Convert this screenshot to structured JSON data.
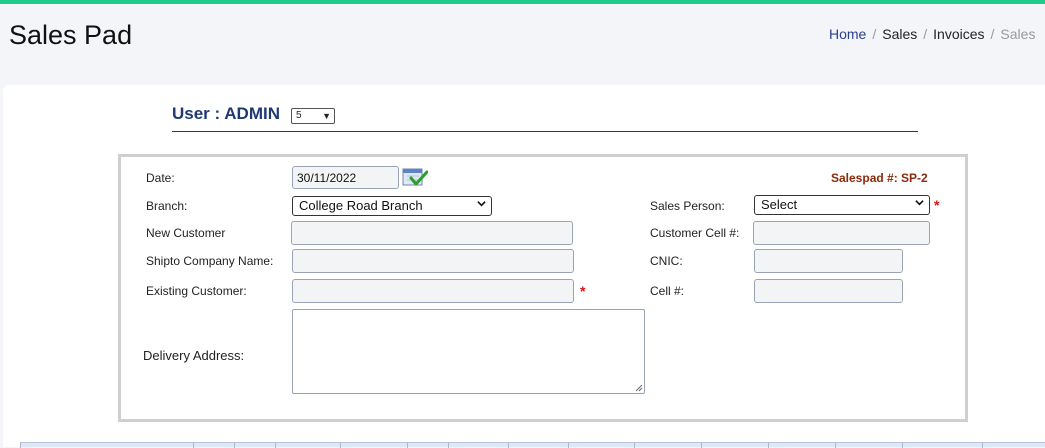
{
  "header": {
    "title": "Sales Pad",
    "breadcrumb": [
      "Home",
      "Sales",
      "Invoices",
      "Sales"
    ],
    "separator": "/"
  },
  "user": {
    "label": "User : ADMIN",
    "selected": "5"
  },
  "form": {
    "date_label": "Date:",
    "date_value": "30/11/2022",
    "salespad_label": "Salespad #: SP-2",
    "branch_label": "Branch:",
    "branch_value": "College Road Branch",
    "sales_person_label": "Sales Person:",
    "sales_person_value": "Select",
    "new_customer_label": "New Customer",
    "new_customer_value": "",
    "customer_cell_label": "Customer Cell #:",
    "customer_cell_value": "",
    "shipto_label": "Shipto Company Name:",
    "shipto_value": "",
    "cnic_label": "CNIC:",
    "cnic_value": "",
    "existing_customer_label": "Existing Customer:",
    "existing_customer_value": "",
    "cell_label": "Cell #:",
    "cell_value": "",
    "delivery_address_label": "Delivery Address:",
    "delivery_address_value": "",
    "required_mark": "*"
  },
  "colors": {
    "accent_bar": "#1fcc8a",
    "user_label": "#1f3a73",
    "salespad": "#8b2a0a",
    "required": "#dd1111",
    "link": "#2b3f8c"
  },
  "icons": {
    "calendar": "calendar-check-icon",
    "dropdown": "chevron-down-icon",
    "resize": "resize-grip-icon"
  }
}
